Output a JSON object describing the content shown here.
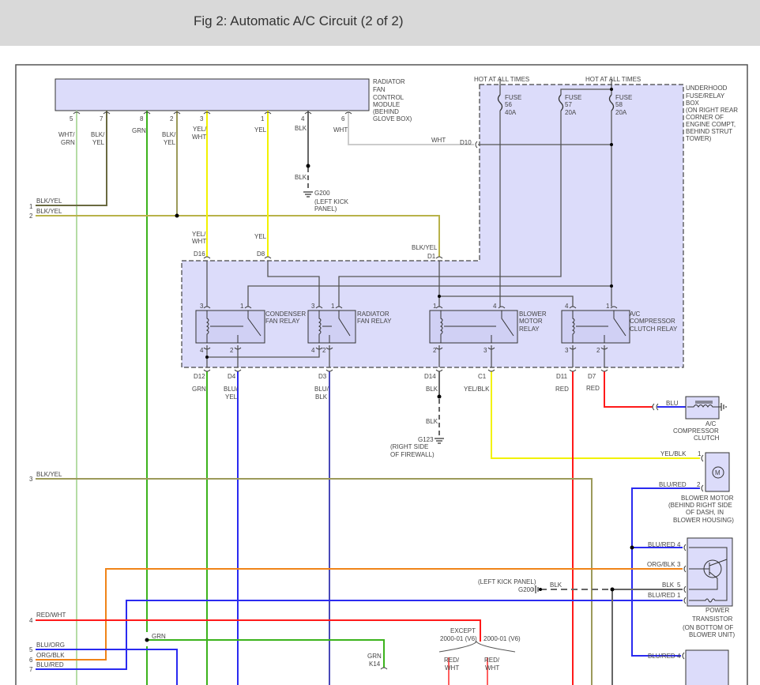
{
  "title": "Fig 2: Automatic A/C Circuit (2 of 2)",
  "colors": {
    "grn": "#3cb31c",
    "yel": "#f2f200",
    "blu": "#2a2af0",
    "bluBlk": "#4848b8",
    "red": "#ff1a1a",
    "org": "#f08418",
    "blkYel": "#9c9a5a",
    "blk": "#808080",
    "wht": "#cccccc",
    "whtGrn": "#b5dca5",
    "box": "#dcdcfa"
  },
  "module": {
    "lines": [
      "RADIATOR",
      "FAN",
      "CONTROL",
      "MODULE",
      "(BEHIND",
      "GLOVE BOX)"
    ],
    "pins": [
      {
        "n": "5",
        "w1": "WHT/",
        "w2": "GRN"
      },
      {
        "n": "7",
        "w1": "BLK/",
        "w2": "YEL"
      },
      {
        "n": "8",
        "w1": "GRN",
        "w2": ""
      },
      {
        "n": "2",
        "w1": "BLK/",
        "w2": "YEL"
      },
      {
        "n": "3",
        "w1": "YEL/",
        "w2": "WHT"
      },
      {
        "n": "1",
        "w1": "YEL",
        "w2": ""
      },
      {
        "n": "4",
        "w1": "BLK",
        "w2": ""
      },
      {
        "n": "6",
        "w1": "WHT",
        "w2": ""
      }
    ]
  },
  "g200_top": {
    "wire": "BLK",
    "name": "G200",
    "l1": "(LEFT KICK",
    "l2": "PANEL)"
  },
  "fusebox": {
    "hot1": "HOT AT ALL TIMES",
    "hot2": "HOT AT ALL TIMES",
    "fuses": [
      {
        "l": "FUSE",
        "n": "56",
        "a": "40A"
      },
      {
        "l": "FUSE",
        "n": "57",
        "a": "20A"
      },
      {
        "l": "FUSE",
        "n": "58",
        "a": "20A"
      }
    ],
    "lines": [
      "UNDERHOOD",
      "FUSE/RELAY",
      "BOX",
      "(ON RIGHT REAR",
      "CORNER OF",
      "ENGINE COMPT,",
      "BEHIND STRUT",
      "TOWER)"
    ],
    "d10_wire": "WHT",
    "d10": "D10"
  },
  "left_lines": [
    {
      "n": "1",
      "w": "BLK/YEL"
    },
    {
      "n": "2",
      "w": "BLK/YEL"
    },
    {
      "n": "3",
      "w": "BLK/YEL"
    },
    {
      "n": "4",
      "w": "RED/WHT"
    },
    {
      "n": "5",
      "w": "BLU/ORG"
    },
    {
      "n": "6",
      "w": "ORG/BLK"
    },
    {
      "n": "7",
      "w": "BLU/RED"
    }
  ],
  "top_conn": {
    "d16_w1": "YEL/",
    "d16_w2": "WHT",
    "d16": "D16",
    "d8_w": "YEL",
    "d8": "D8",
    "d1_w": "BLK/YEL",
    "d1": "D1"
  },
  "relays": [
    {
      "l1": "CONDENSER",
      "l2": "FAN RELAY",
      "l3": "",
      "pins": [
        "3",
        "1",
        "4",
        "2"
      ]
    },
    {
      "l1": "RADIATOR",
      "l2": "FAN RELAY",
      "l3": "",
      "pins": [
        "3",
        "1",
        "4",
        "2"
      ]
    },
    {
      "l1": "BLOWER",
      "l2": "MOTOR",
      "l3": "RELAY",
      "pins": [
        "1",
        "4",
        "2",
        "3"
      ]
    },
    {
      "l1": "A/C",
      "l2": "COMPRESSOR",
      "l3": "CLUTCH RELAY",
      "pins": [
        "4",
        "1",
        "3",
        "2"
      ]
    }
  ],
  "bottom_conn": [
    {
      "c": "D12",
      "w1": "GRN",
      "w2": ""
    },
    {
      "c": "D4",
      "w1": "BLU/",
      "w2": "YEL"
    },
    {
      "c": "D3",
      "w1": "BLU/",
      "w2": "BLK"
    },
    {
      "c": "D14",
      "w1": "BLK",
      "w2": ""
    },
    {
      "c": "C1",
      "w1": "YEL/BLK",
      "w2": ""
    },
    {
      "c": "D11",
      "w1": "RED",
      "w2": ""
    },
    {
      "c": "D7",
      "w1": "RED",
      "w2": ""
    }
  ],
  "g123": {
    "wire": "BLK",
    "name": "G123",
    "l1": "(RIGHT SIDE",
    "l2": "OF FIREWALL)"
  },
  "clutch": {
    "wire": "BLU",
    "lines": [
      "A/C",
      "COMPRESSOR",
      "CLUTCH"
    ]
  },
  "blower": {
    "p1": "1",
    "w1": "YEL/BLK",
    "p2": "2",
    "w2": "BLU/RED",
    "lines": [
      "BLOWER MOTOR",
      "(BEHIND RIGHT SIDE",
      "OF DASH, IN",
      "BLOWER HOUSING)"
    ],
    "symbol": "M"
  },
  "transistor": {
    "pins": [
      {
        "n": "4",
        "w": "BLU/RED"
      },
      {
        "n": "3",
        "w": "ORG/BLK"
      },
      {
        "n": "5",
        "w": "BLK"
      },
      {
        "n": "1",
        "w": "BLU/RED"
      }
    ],
    "lines": [
      "POWER",
      "TRANSISTOR",
      "(ON BOTTOM OF",
      "BLOWER UNIT)"
    ]
  },
  "g200_bottom": {
    "l": "(LEFT KICK PANEL)",
    "name": "G200",
    "wire": "BLK"
  },
  "misc": {
    "grn": "GRN",
    "k14_w": "GRN",
    "k14": "K14",
    "except": "EXCEPT",
    "v6a": "2000-01 (V6)",
    "v6b": "2000-01 (V6)",
    "rw1a": "RED/",
    "rw1b": "WHT",
    "rw2a": "RED/",
    "rw2b": "WHT",
    "lower_pin": "4",
    "lower_w": "BLU/RED"
  }
}
